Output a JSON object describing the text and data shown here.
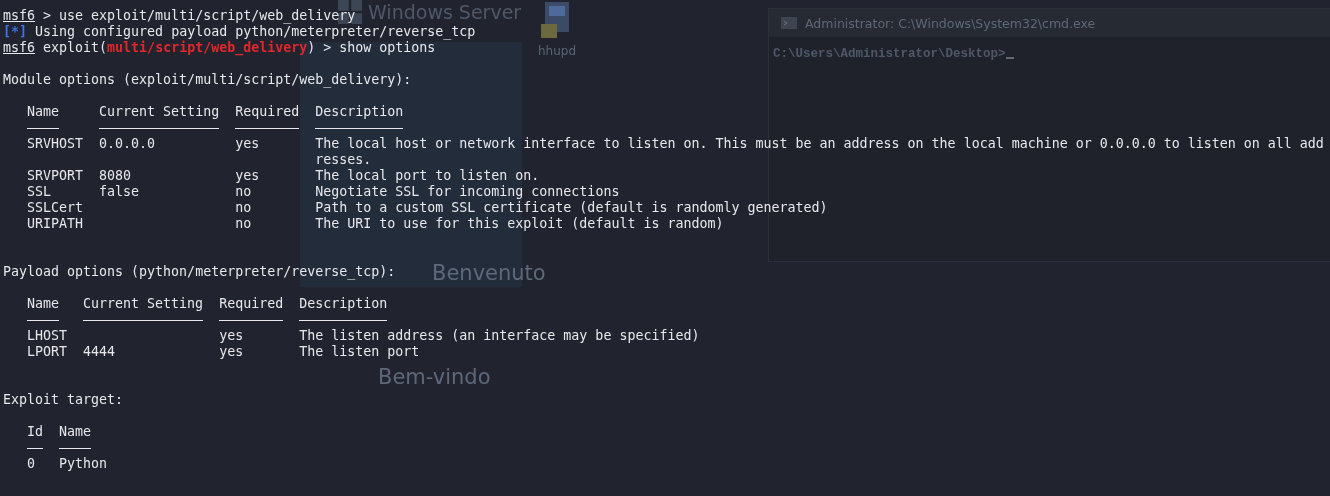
{
  "desktop": {
    "heading": "Windows Server",
    "icon_label": "hhupd",
    "cmd_window": {
      "title": "Administrator: C:\\Windows\\System32\\cmd.exe",
      "prompt": "C:\\Users\\Administrator\\Desktop>"
    },
    "greetings": [
      "Benvenuto",
      "Bem-vindo"
    ]
  },
  "terminal": {
    "lines": [
      {
        "kind": "prompt",
        "prompt": "msf6",
        "input": " > use exploit/multi/script/web_delivery"
      },
      {
        "kind": "status",
        "marker": "[*]",
        "text": "Using configured payload python/meterpreter/reverse_tcp"
      },
      {
        "kind": "prompt",
        "prompt": "msf6",
        "context": "exploit(",
        "module": "multi/script/web_delivery",
        "input": ") > show options"
      }
    ],
    "sections": [
      {
        "title": "Module options (exploit/multi/script/web_delivery):",
        "columns": [
          "Name",
          "Current Setting",
          "Required",
          "Description"
        ],
        "rows": [
          [
            "SRVHOST",
            "0.0.0.0",
            "yes",
            "The local host or network interface to listen on. This must be an address on the local machine or 0.0.0.0 to listen on all addresses."
          ],
          [
            "SRVPORT",
            "8080",
            "yes",
            "The local port to listen on."
          ],
          [
            "SSL",
            "false",
            "no",
            "Negotiate SSL for incoming connections"
          ],
          [
            "SSLCert",
            null,
            "no",
            "Path to a custom SSL certificate (default is randomly generated)"
          ],
          [
            "URIPATH",
            null,
            "no",
            "The URI to use for this exploit (default is random)"
          ]
        ]
      },
      {
        "title": "Payload options (python/meterpreter/reverse_tcp):",
        "columns": [
          "Name",
          "Current Setting",
          "Required",
          "Description"
        ],
        "rows": [
          [
            "LHOST",
            null,
            "yes",
            "The listen address (an interface may be specified)"
          ],
          [
            "LPORT",
            "4444",
            "yes",
            "The listen port"
          ]
        ]
      },
      {
        "title": "Exploit target:",
        "columns": [
          "Id",
          "Name"
        ],
        "rows": [
          [
            "0",
            "Python"
          ]
        ]
      }
    ]
  }
}
